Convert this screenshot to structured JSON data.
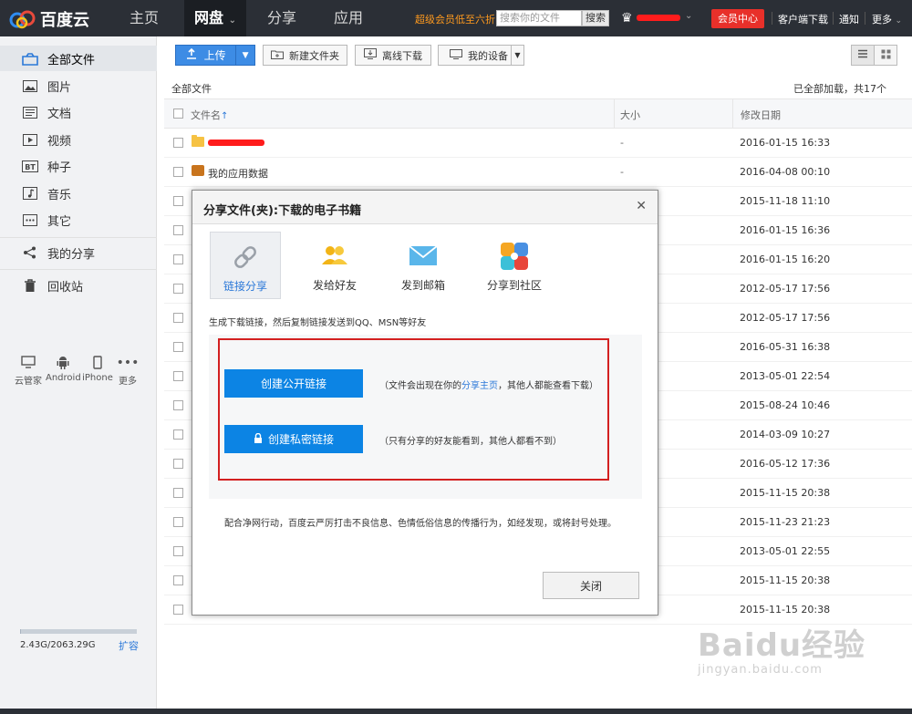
{
  "topbar": {
    "logo_text": "百度云",
    "nav": [
      "主页",
      "网盘",
      "分享",
      "应用"
    ],
    "promo": "超级会员低至六折",
    "search_placeholder": "搜索你的文件",
    "search_button": "搜索",
    "vip_center": "会员中心",
    "links": [
      "客户端下载",
      "通知",
      "更多"
    ]
  },
  "sidebar": {
    "items": [
      {
        "label": "全部文件",
        "icon": "folder-outline-icon"
      },
      {
        "label": "图片",
        "icon": "image-icon"
      },
      {
        "label": "文档",
        "icon": "document-icon"
      },
      {
        "label": "视频",
        "icon": "video-icon"
      },
      {
        "label": "种子",
        "icon": "bt-icon"
      },
      {
        "label": "音乐",
        "icon": "music-icon"
      },
      {
        "label": "其它",
        "icon": "more-icon"
      },
      {
        "label": "我的分享",
        "icon": "share-icon"
      },
      {
        "label": "回收站",
        "icon": "trash-icon"
      }
    ],
    "devices": [
      "云管家",
      "Android",
      "iPhone",
      "更多"
    ],
    "quota": "2.43G/2063.29G",
    "quota_fraction": 0.0012,
    "expand": "扩容"
  },
  "toolbar": {
    "upload": "上传",
    "new_folder": "新建文件夹",
    "offline": "离线下载",
    "devices": "我的设备"
  },
  "list": {
    "breadcrumb": "全部文件",
    "loaded": "已全部加载，共17个",
    "headers": {
      "name": "文件名",
      "size": "大小",
      "date": "修改日期"
    },
    "rows": [
      {
        "name": "",
        "size": "-",
        "date": "2016-01-15 16:33"
      },
      {
        "name": "我的应用数据",
        "size": "-",
        "date": "2016-04-08 00:10"
      },
      {
        "date": "2015-11-18 11:10"
      },
      {
        "date": "2016-01-15 16:36"
      },
      {
        "date": "2016-01-15 16:20"
      },
      {
        "date": "2012-05-17 17:56"
      },
      {
        "date": "2012-05-17 17:56"
      },
      {
        "date": "2016-05-31 16:38"
      },
      {
        "date": "2013-05-01 22:54"
      },
      {
        "date": "2015-08-24 10:46"
      },
      {
        "date": "2014-03-09 10:27"
      },
      {
        "date": "2016-05-12 17:36"
      },
      {
        "date": "2015-11-15 20:38"
      },
      {
        "date": "2015-11-23 21:23"
      },
      {
        "date": "2013-05-01 22:55"
      },
      {
        "date": "2015-11-15 20:38"
      },
      {
        "date": "2015-11-15 20:38"
      }
    ]
  },
  "modal": {
    "title": "分享文件(夹):下载的电子书籍",
    "tabs": [
      "链接分享",
      "发给好友",
      "发到邮箱",
      "分享到社区"
    ],
    "hint": "生成下载链接，然后复制链接发送到QQ、MSN等好友",
    "public_button": "创建公开链接",
    "public_note_pre": "（文件会出现在你的",
    "public_note_link": "分享主页",
    "public_note_post": "，其他人都能查看下载）",
    "private_button": "创建私密链接",
    "private_note": "（只有分享的好友能看到，其他人都看不到）",
    "notice": "配合净网行动，百度云严厉打击不良信息、色情低俗信息的传播行为，如经发现，或将封号处理。",
    "close": "关闭"
  },
  "watermark": {
    "main": "Baidu经验",
    "sub": "jingyan.baidu.com"
  }
}
